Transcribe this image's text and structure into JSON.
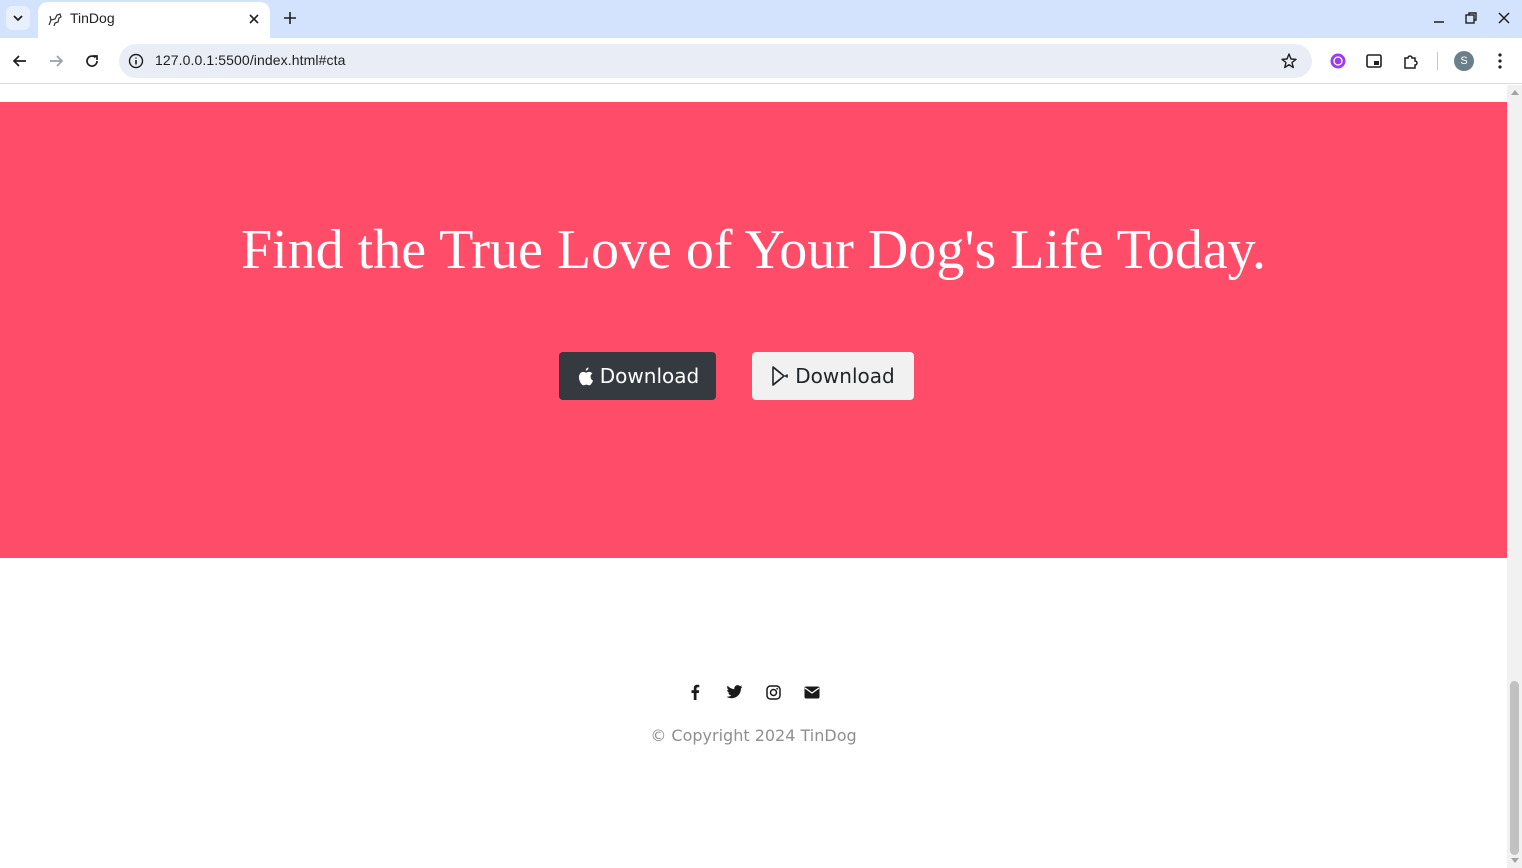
{
  "browser": {
    "tab_title": "TinDog",
    "url": "127.0.0.1:5500/index.html#cta",
    "profile_initial": "S"
  },
  "cta": {
    "heading": "Find the True Love of Your Dog's Life Today.",
    "apple_button_label": "Download",
    "google_button_label": "Download"
  },
  "footer": {
    "copyright": "© Copyright 2024 TinDog",
    "social_icons": [
      "facebook-icon",
      "twitter-icon",
      "instagram-icon",
      "envelope-icon"
    ]
  },
  "colors": {
    "cta_background": "#ff4c68",
    "dark_button": "#343a40",
    "light_button": "#f1f1f1",
    "tabbar": "#d3e3fd"
  }
}
